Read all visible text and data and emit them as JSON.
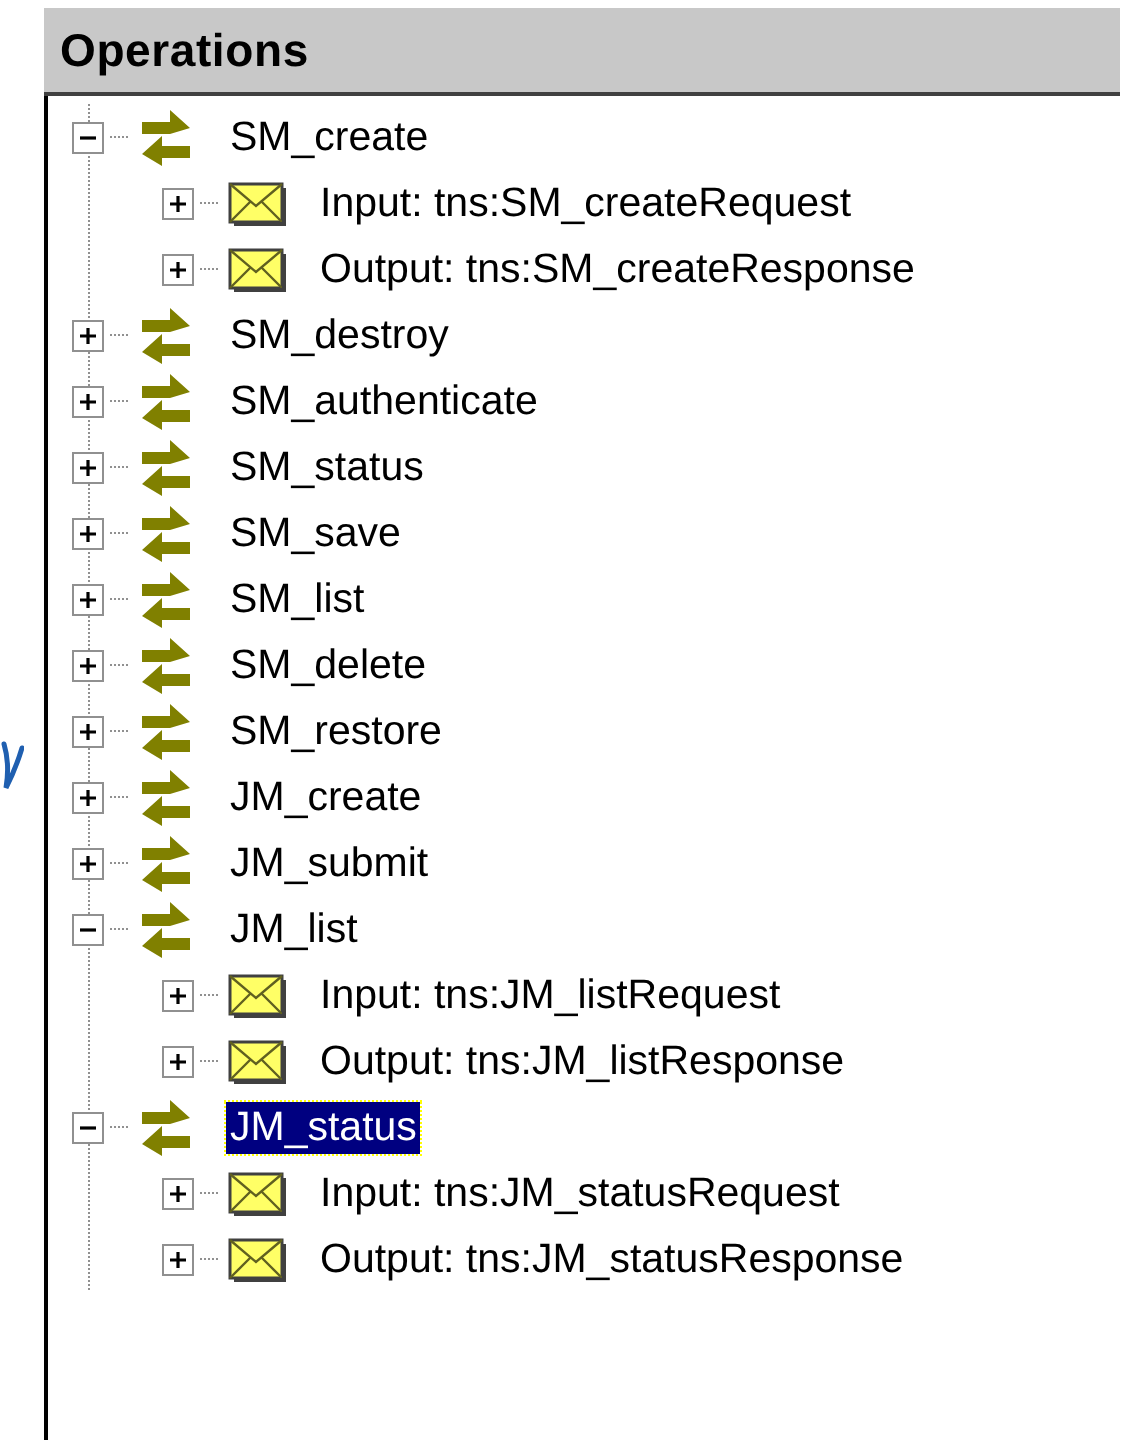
{
  "panel": {
    "title": "Operations"
  },
  "operations": [
    {
      "kind": "operation",
      "label": "SM_create",
      "expanded": true,
      "selected": false,
      "children": [
        {
          "kind": "message",
          "label": "Input: tns:SM_createRequest",
          "expanded": false,
          "selected": false
        },
        {
          "kind": "message",
          "label": "Output: tns:SM_createResponse",
          "expanded": false,
          "selected": false
        }
      ]
    },
    {
      "kind": "operation",
      "label": "SM_destroy",
      "expanded": false,
      "selected": false
    },
    {
      "kind": "operation",
      "label": "SM_authenticate",
      "expanded": false,
      "selected": false
    },
    {
      "kind": "operation",
      "label": "SM_status",
      "expanded": false,
      "selected": false
    },
    {
      "kind": "operation",
      "label": "SM_save",
      "expanded": false,
      "selected": false
    },
    {
      "kind": "operation",
      "label": "SM_list",
      "expanded": false,
      "selected": false
    },
    {
      "kind": "operation",
      "label": "SM_delete",
      "expanded": false,
      "selected": false
    },
    {
      "kind": "operation",
      "label": "SM_restore",
      "expanded": false,
      "selected": false
    },
    {
      "kind": "operation",
      "label": "JM_create",
      "expanded": false,
      "selected": false
    },
    {
      "kind": "operation",
      "label": "JM_submit",
      "expanded": false,
      "selected": false
    },
    {
      "kind": "operation",
      "label": "JM_list",
      "expanded": true,
      "selected": false,
      "children": [
        {
          "kind": "message",
          "label": "Input: tns:JM_listRequest",
          "expanded": false,
          "selected": false
        },
        {
          "kind": "message",
          "label": "Output: tns:JM_listResponse",
          "expanded": false,
          "selected": false
        }
      ]
    },
    {
      "kind": "operation",
      "label": "JM_status",
      "expanded": true,
      "selected": true,
      "children": [
        {
          "kind": "message",
          "label": "Input: tns:JM_statusRequest",
          "expanded": false,
          "selected": false
        },
        {
          "kind": "message",
          "label": "Output: tns:JM_statusResponse",
          "expanded": false,
          "selected": false
        }
      ]
    }
  ]
}
